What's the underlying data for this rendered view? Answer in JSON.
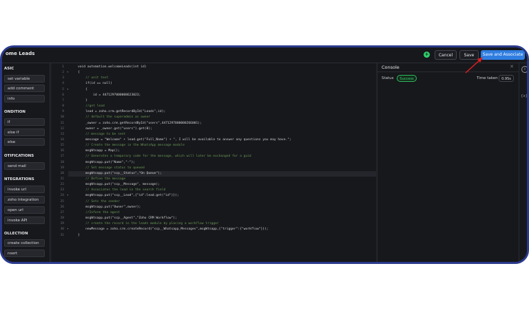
{
  "header": {
    "title": "ome Leads",
    "zia_icon": "plus-circle-icon",
    "cancel_label": "Cancel",
    "save_label": "Save",
    "save_assoc_label": "Save and Associate"
  },
  "sidebar": {
    "sections": [
      {
        "label": "ASIC",
        "items": [
          "set variable",
          "add comment",
          "info"
        ]
      },
      {
        "label": "ONDITION",
        "items": [
          "if",
          "else if",
          "else"
        ]
      },
      {
        "label": "OTIFICATIONS",
        "items": [
          "send mail"
        ]
      },
      {
        "label": "NTEGRATIONS",
        "items": [
          "invoke url",
          "zoho integration",
          "open url",
          "invoke API"
        ]
      },
      {
        "label": "OLLECTION",
        "items": [
          "create collection",
          "nsert"
        ]
      }
    ]
  },
  "editor": {
    "lines": [
      "void automation.welcomeLeads(int id)",
      "{",
      "    // unit test",
      "    if(id == null)",
      "    {",
      "        id = 4471297000008623023;",
      "    }",
      "    //get lead",
      "    lead = zoho.crm.getRecordById(\"Leads\",id);",
      "    // default the superadmin as owner",
      "    _owner = zoho.crm.getRecordById(\"users\",4471297000000266001);",
      "    owner = _owner.get(\"users\").get(0);",
      "    // message to be sent",
      "    message = \"Welcome\" + lead.get(\"Full_Name\") + \", I will be available to answer any questions you may have.\";",
      "    // Create the message in the WhatsApp message module",
      "    msgWtsapp = Map();",
      "    // Generates a temporary code for the message, which will later be exchanged for a guid",
      "    msgWtsapp.put(\"Name\",\"-\");",
      "    // Set message status to queued",
      "    msgWtsapp.put(\"scp__Status\",\"On Queue\");",
      "    // Define the message",
      "    msgWtsapp.put(\"scp__Message\", message);",
      "    // Associates the lead in the search field",
      "    msgWtsapp.put(\"scp__Lead\",{\"id\":lead.get(\"id\")});",
      "    // Sets the sender",
      "    msgWtsapp.put(\"Owner\",owner);",
      "    //Inform the agent",
      "    msgWtsapp.put(\"scp__Agent\",\"Zoho CRM Workflow\");",
      "    // create the record in the leads module by placing a workflow trigger",
      "    newMessage = zoho.crm.createRecord(\"scp__Whatsapp_Messages\",msgWtsapp,{\"trigger\":{\"workflow\"}});",
      "}"
    ]
  },
  "console": {
    "title": "Console",
    "close_icon": "close-icon",
    "status_label": "Status",
    "status_value": "Success",
    "time_label": "Time taken",
    "time_value": "0.95s"
  },
  "rail": {
    "info_icon": "info-icon",
    "variables_icon": "variables-icon",
    "variables_text": "{x}"
  },
  "colors": {
    "accent": "#2f7de1",
    "success": "#3bd16f",
    "background": "#1d1e24",
    "annotation_arrow": "#e02020"
  }
}
